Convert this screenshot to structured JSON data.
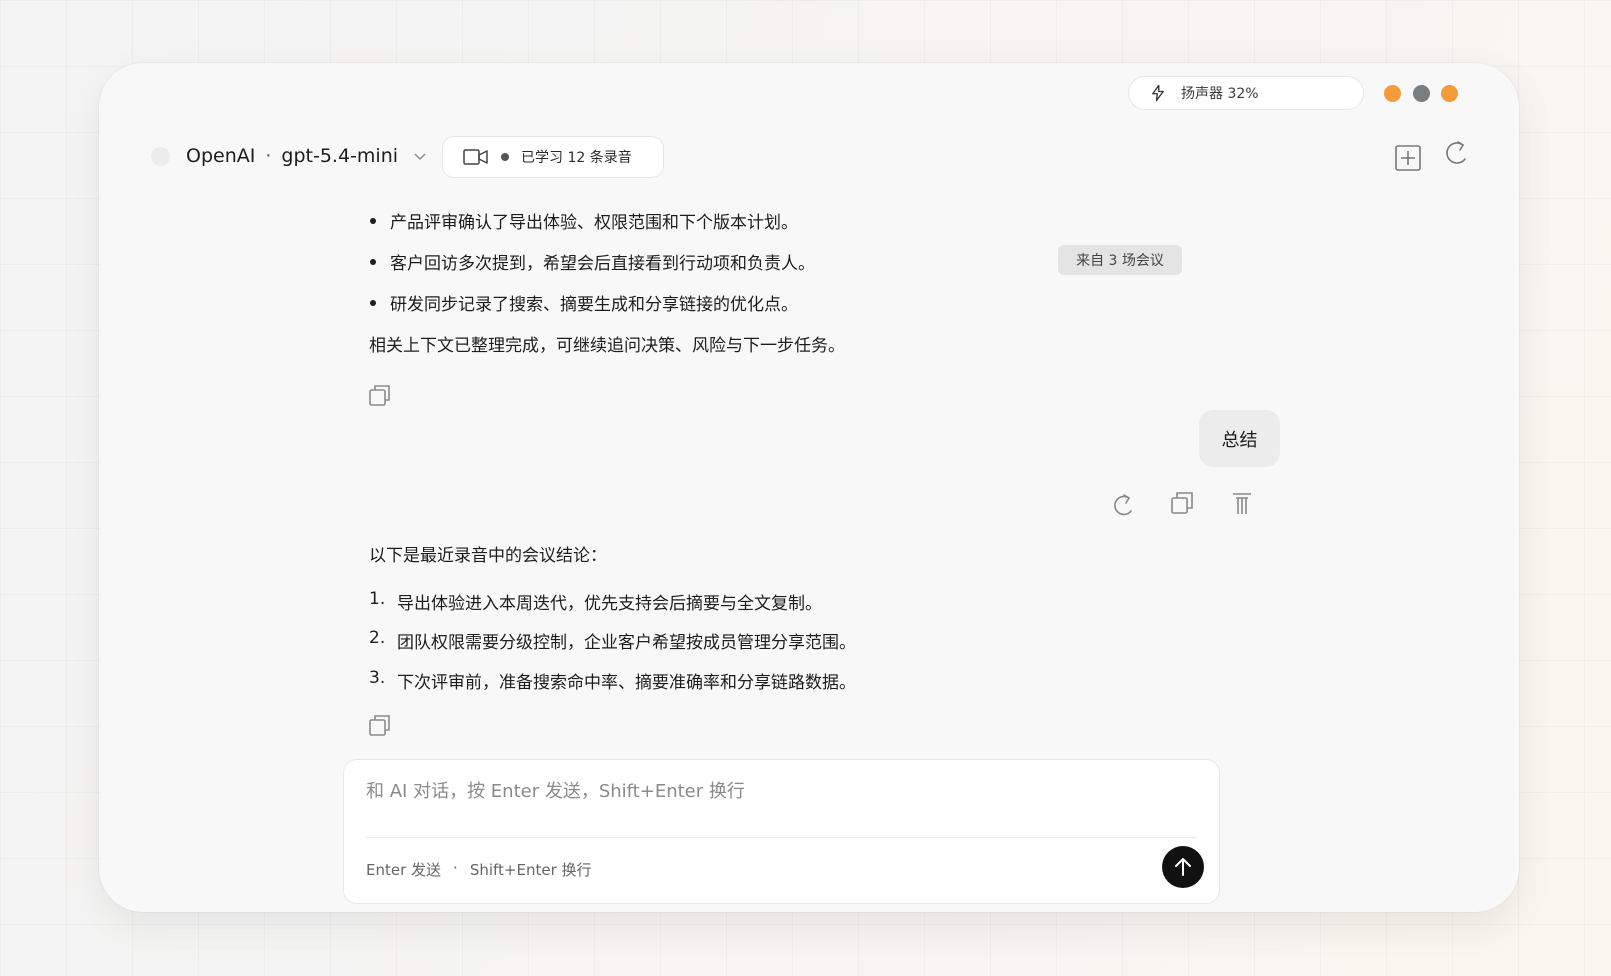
{
  "status": {
    "speaker_label": "扬声器 32%",
    "bolt_icon": "bolt-icon",
    "window_dots": [
      {
        "name": "dot-orange-1",
        "color": "#f39a3a"
      },
      {
        "name": "dot-gray",
        "color": "#7a7e80"
      },
      {
        "name": "dot-orange-2",
        "color": "#f39a3a"
      }
    ]
  },
  "header": {
    "provider": "OpenAI",
    "separator": "·",
    "model": "gpt-5.4-mini",
    "learned_label": "已学习 12 条录音",
    "new_chat_icon": "plus-square-icon",
    "refresh_icon": "refresh-icon"
  },
  "messages": {
    "first_answer": {
      "bullets": [
        "产品评审确认了导出体验、权限范围和下个版本计划。",
        "客户回访多次提到，希望会后直接看到行动项和负责人。",
        "研发同步记录了搜索、摘要生成和分享链接的优化点。"
      ],
      "closing": "相关上下文已整理完成，可继续追问决策、风险与下一步任务。",
      "source_badge": "来自 3 场会议"
    },
    "user_message": "总结",
    "second_answer": {
      "intro": "以下是最近录音中的会议结论：",
      "items": [
        {
          "num": "1.",
          "text": "导出体验进入本周迭代，优先支持会后摘要与全文复制。"
        },
        {
          "num": "2.",
          "text": "团队权限需要分级控制，企业客户希望按成员管理分享范围。"
        },
        {
          "num": "3.",
          "text": "下次评审前，准备搜索命中率、摘要准确率和分享链路数据。"
        }
      ]
    }
  },
  "composer": {
    "placeholder": "和 AI 对话，按 Enter 发送，Shift+Enter 换行",
    "value": "",
    "hint_send": "Enter 发送",
    "hint_sep": "·",
    "hint_newline": "Shift+Enter 换行",
    "send_icon": "arrow-up-icon"
  }
}
